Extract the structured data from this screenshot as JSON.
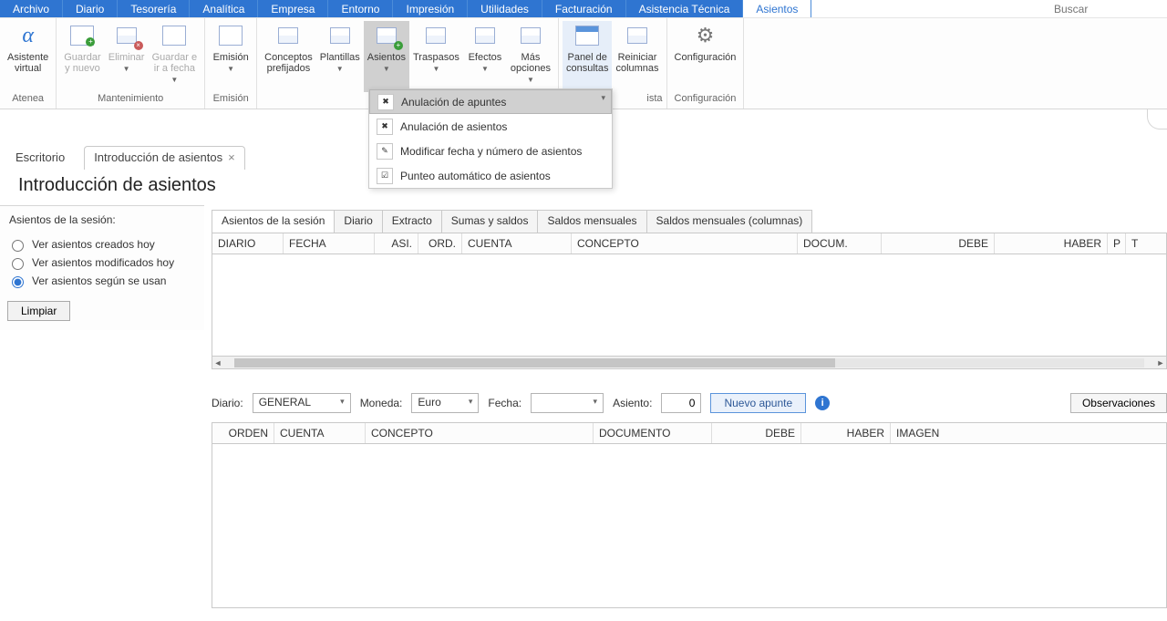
{
  "menu": {
    "archivo": "Archivo",
    "diario": "Diario",
    "tesoreria": "Tesorería",
    "analitica": "Analítica",
    "empresa": "Empresa",
    "entorno": "Entorno",
    "impresion": "Impresión",
    "utilidades": "Utilidades",
    "facturacion": "Facturación",
    "asistencia": "Asistencia Técnica",
    "asientos": "Asientos",
    "search_placeholder": "Buscar"
  },
  "ribbon": {
    "atenea": {
      "l1": "Asistente",
      "l2": "virtual",
      "group": "Atenea"
    },
    "mant": {
      "guardar_nuevo": {
        "l1": "Guardar",
        "l2": "y nuevo"
      },
      "eliminar": {
        "l1": "Eliminar"
      },
      "guardar_fecha": {
        "l1": "Guardar e",
        "l2": "ir a fecha"
      },
      "group": "Mantenimiento"
    },
    "emision": {
      "btn": "Emisión",
      "group": "Emisión"
    },
    "plain": {
      "conceptos": {
        "l1": "Conceptos",
        "l2": "prefijados"
      },
      "plantillas": "Plantillas",
      "asientos": "Asientos",
      "traspasos": "Traspasos",
      "efectos": "Efectos",
      "mas": {
        "l1": "Más",
        "l2": "opciones"
      }
    },
    "vista": {
      "panel": {
        "l1": "Panel de",
        "l2": "consultas"
      },
      "reiniciar": {
        "l1": "Reiniciar",
        "l2": "columnas"
      },
      "group": "ista"
    },
    "conf": {
      "btn": "Configuración",
      "group": "Configuración"
    }
  },
  "dropdown": {
    "anul_apuntes": "Anulación de apuntes",
    "anul_asientos": "Anulación de asientos",
    "modificar": "Modificar fecha y número de asientos",
    "punteo": "Punteo automático de asientos"
  },
  "tabs": {
    "escritorio": "Escritorio",
    "introduccion": "Introducción de asientos"
  },
  "title": "Introducción de asientos",
  "side": {
    "header": "Asientos de la sesión:",
    "r1": "Ver asientos creados hoy",
    "r2": "Ver asientos modificados hoy",
    "r3": "Ver asientos según se usan",
    "limpiar": "Limpiar"
  },
  "innertabs": {
    "t1": "Asientos de la sesión",
    "t2": "Diario",
    "t3": "Extracto",
    "t4": "Sumas y saldos",
    "t5": "Saldos mensuales",
    "t6": "Saldos mensuales (columnas)"
  },
  "cols1": {
    "diario": "DIARIO",
    "fecha": "FECHA",
    "asi": "ASI.",
    "ord": "ORD.",
    "cuenta": "CUENTA",
    "concepto": "CONCEPTO",
    "docum": "DOCUM.",
    "debe": "DEBE",
    "haber": "HABER",
    "p": "P",
    "t": "T"
  },
  "form": {
    "diario_label": "Diario:",
    "diario_value": "GENERAL",
    "moneda_label": "Moneda:",
    "moneda_value": "Euro",
    "fecha_label": "Fecha:",
    "fecha_value": "",
    "asiento_label": "Asiento:",
    "asiento_value": "0",
    "nuevo": "Nuevo apunte",
    "observaciones": "Observaciones"
  },
  "cols2": {
    "orden": "ORDEN",
    "cuenta": "CUENTA",
    "concepto": "CONCEPTO",
    "documento": "DOCUMENTO",
    "debe": "DEBE",
    "haber": "HABER",
    "imagen": "IMAGEN"
  }
}
